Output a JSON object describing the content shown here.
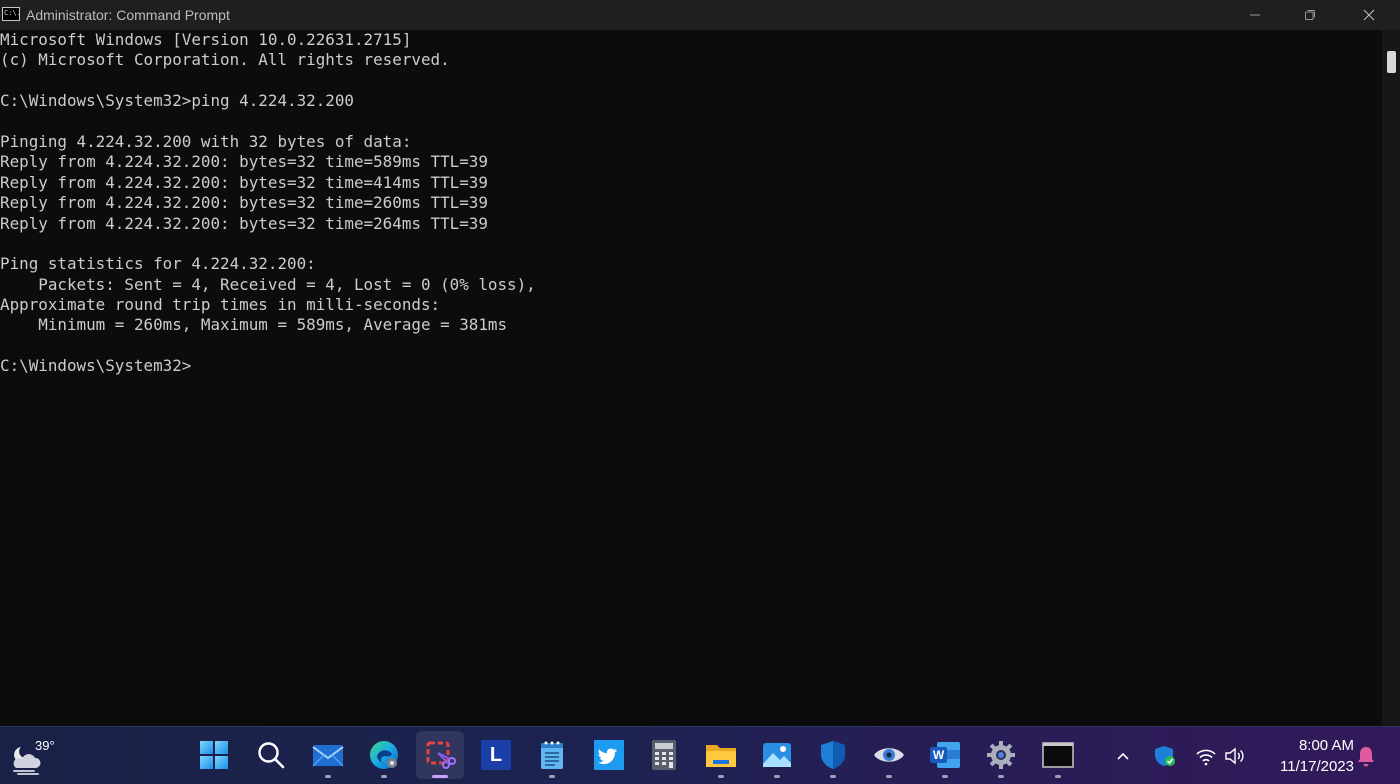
{
  "window": {
    "title": "Administrator: Command Prompt",
    "icon_name": "cmd-icon",
    "icon_text": "C:\\."
  },
  "controls": {
    "minimize": "minimize-icon",
    "maximize": "restore-icon",
    "close": "close-icon"
  },
  "console": {
    "text_color": "#cccccc",
    "background": "#0c0c0c",
    "lines": [
      "Microsoft Windows [Version 10.0.22631.2715]",
      "(c) Microsoft Corporation. All rights reserved.",
      "",
      "C:\\Windows\\System32>ping 4.224.32.200",
      "",
      "Pinging 4.224.32.200 with 32 bytes of data:",
      "Reply from 4.224.32.200: bytes=32 time=589ms TTL=39",
      "Reply from 4.224.32.200: bytes=32 time=414ms TTL=39",
      "Reply from 4.224.32.200: bytes=32 time=260ms TTL=39",
      "Reply from 4.224.32.200: bytes=32 time=264ms TTL=39",
      "",
      "Ping statistics for 4.224.32.200:",
      "    Packets: Sent = 4, Received = 4, Lost = 0 (0% loss),",
      "Approximate round trip times in milli-seconds:",
      "    Minimum = 260ms, Maximum = 589ms, Average = 381ms",
      "",
      "C:\\Windows\\System32>"
    ]
  },
  "taskbar": {
    "weather": {
      "temp": "39°",
      "icon": "cloudy-night-icon"
    },
    "apps": [
      {
        "name": "start-button",
        "icon": "windows-logo-icon",
        "active": false,
        "running": false
      },
      {
        "name": "search-button",
        "icon": "search-icon",
        "active": false,
        "running": false
      },
      {
        "name": "mail-app",
        "icon": "mail-icon",
        "active": false,
        "running": true
      },
      {
        "name": "edge-app",
        "icon": "edge-icon",
        "active": false,
        "running": true
      },
      {
        "name": "snipping-tool-app",
        "icon": "snipping-tool-icon",
        "active": true,
        "running": true
      },
      {
        "name": "l-app",
        "icon": "letter-l-icon",
        "label": "L",
        "active": false,
        "running": false
      },
      {
        "name": "notepad-app",
        "icon": "notepad-icon",
        "active": false,
        "running": true
      },
      {
        "name": "twitter-app",
        "icon": "twitter-icon",
        "active": false,
        "running": false
      },
      {
        "name": "calculator-app",
        "icon": "calculator-icon",
        "active": false,
        "running": false
      },
      {
        "name": "file-explorer-app",
        "icon": "folder-icon",
        "active": false,
        "running": true
      },
      {
        "name": "photos-app",
        "icon": "photos-icon",
        "active": false,
        "running": true
      },
      {
        "name": "defender-app",
        "icon": "shield-icon",
        "active": false,
        "running": true
      },
      {
        "name": "eye-app",
        "icon": "eye-icon",
        "active": false,
        "running": true
      },
      {
        "name": "word-app",
        "icon": "word-icon",
        "label": "W",
        "active": false,
        "running": true
      },
      {
        "name": "settings-app",
        "icon": "gear-icon",
        "active": false,
        "running": true
      },
      {
        "name": "terminal-app",
        "icon": "terminal-icon",
        "active": false,
        "running": true
      }
    ]
  },
  "tray": {
    "chevron": "chevron-up-icon",
    "security": "security-shield-icon",
    "wifi": "wifi-icon",
    "volume": "volume-icon",
    "time": "8:00 AM",
    "date": "11/17/2023",
    "notifications": "bell-icon"
  },
  "colors": {
    "titlebar": "#1f1f1f",
    "taskbar_start": "#1a2146",
    "taskbar_end": "#321a5a",
    "accent_indicator": "#c9a0ff"
  }
}
